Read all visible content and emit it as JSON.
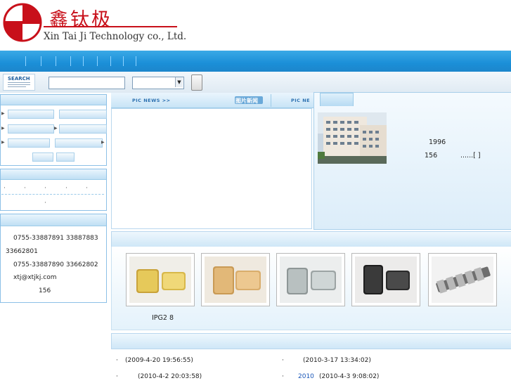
{
  "header": {
    "brand_cn": "鑫钛极",
    "brand_en": "Xin Tai Ji Technology co., Ltd."
  },
  "search": {
    "label": "SEARCH",
    "input_value": "",
    "select_value": ""
  },
  "contact": {
    "tel": "0755-33887891 33887883",
    "tel_cont": "33662801",
    "fax": "0755-33887890 33662802",
    "email": "xtj@xtjkj.com",
    "address": "156"
  },
  "picnews": {
    "label_1": "PIC NEWS >>",
    "tag": "图片新闻",
    "label_2": "PIC NE"
  },
  "about": {
    "year": "1996",
    "num": "156",
    "more": "......[   ]"
  },
  "products": {
    "caption": "IPG2  8"
  },
  "news": [
    {
      "bullet": "·",
      "text": "(2009-4-20 19:56:55)"
    },
    {
      "bullet": "·",
      "text": "(2010-3-17 13:34:02)"
    },
    {
      "bullet": "·",
      "text": "(2010-4-2 20:03:58)"
    },
    {
      "bullet": "·",
      "prefix": "2010",
      "text": "(2010-4-3 9:08:02)"
    }
  ],
  "colors": {
    "brand_red": "#c8101a",
    "nav_blue": "#1b8fd8",
    "panel_border": "#8cc0e6",
    "link_blue": "#1a57b8"
  }
}
